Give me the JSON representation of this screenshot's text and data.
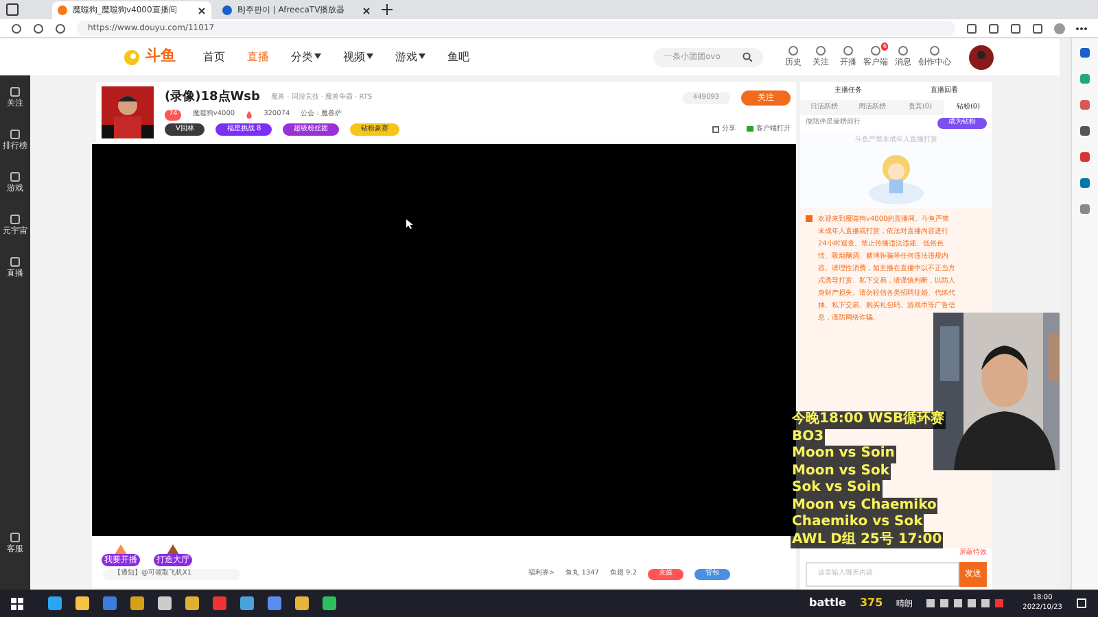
{
  "browser": {
    "tabs": [
      {
        "title": "魔噬狗_魔噬狗v4000直播间",
        "selected": true
      },
      {
        "title": "BJ주판이 | AfreecaTV播放器",
        "selected": false
      }
    ],
    "url": "https://www.douyu.com/11017"
  },
  "site": {
    "logo": "斗鱼",
    "nav": [
      {
        "label": "首页",
        "selected": false,
        "caret": false
      },
      {
        "label": "直播",
        "selected": true,
        "caret": false
      },
      {
        "label": "分类",
        "selected": false,
        "caret": true
      },
      {
        "label": "视频",
        "selected": false,
        "caret": true
      },
      {
        "label": "游戏",
        "selected": false,
        "caret": true
      },
      {
        "label": "鱼吧",
        "selected": false,
        "caret": false
      }
    ],
    "search_placeholder": "一条小团团ovo",
    "header_icons": [
      {
        "label": "历史"
      },
      {
        "label": "关注"
      },
      {
        "label": "开播"
      },
      {
        "label": "客户端",
        "badge": "6"
      },
      {
        "label": "消息"
      },
      {
        "label": "创作中心"
      }
    ]
  },
  "left_rail": [
    {
      "label": "关注"
    },
    {
      "label": "排行榜"
    },
    {
      "label": "游戏"
    },
    {
      "label": "元宇宙"
    },
    {
      "label": "直播"
    },
    {
      "label": "客服"
    }
  ],
  "streamer": {
    "title": "(录像)18点Wsb",
    "tags": "魔兽 · 同游竞技 · 魔兽争霸 · RTS",
    "level": "74",
    "name": "魔噬狗v4000",
    "hot": "320074",
    "notice": "公会：魔兽萨",
    "badges": [
      {
        "label": "V回林",
        "color": "#3a3a3a"
      },
      {
        "label": "福星挑战 8",
        "color": "#7b2ff7"
      },
      {
        "label": "超级粉丝团",
        "color": "#9b30d9"
      },
      {
        "label": "钻粉豪赛",
        "color": "#f5c518"
      }
    ],
    "followers": "449093",
    "follow": "关注",
    "share": "分享",
    "client": "客户端打开"
  },
  "panel": {
    "links": [
      "主播任务",
      "直播回看"
    ],
    "tabs": [
      {
        "label": "日活跃榜",
        "selected": false
      },
      {
        "label": "周活跃榜",
        "selected": false
      },
      {
        "label": "贵宾(0)",
        "selected": false
      },
      {
        "label": "钻粉(0)",
        "selected": true
      }
    ],
    "rank_text": "做陪伴星量榜前行",
    "rank_button": "成为钻粉",
    "empty_text": "斗鱼严禁未成年人直播打赏",
    "system_message": "欢迎来到魔噬狗v4000的直播间。斗鱼严禁未成年人直播或打赏，依法对直播内容进行24小时巡查。禁止传播违法违规、低俗色情、吸烟酗酒、赌博诈骗等任何违法违规内容。请理性消费，如主播在直播中以不正当方式诱导打赏、私下交易，请谨慎判断，以防人身财产损失。请勿轻信各类招聘征婚、代练代抽、私下交易、购买礼包码、游戏币等广告信息，谨防网络诈骗。"
  },
  "overlay_lines": [
    "今晚18:00 WSB循环赛",
    "BO3",
    "Moon vs Soin",
    "Moon vs Sok",
    "Sok vs Soin",
    "Moon vs Chaemiko",
    "Chaemiko vs Sok",
    "AWL D组 25号 17:00"
  ],
  "bottom": {
    "gifts": [
      "我要开播",
      "打造大厅"
    ],
    "notice": "【通知】@可领取飞机X1",
    "coupon": "福利券>",
    "fish_balls": "鱼丸 1347",
    "fish_fins": "鱼翅 9.2",
    "recharge": "充值",
    "backpack": "背包",
    "block_effects": "屏蔽特效",
    "chat_placeholder": "这里输入聊天内容",
    "send": "发送"
  },
  "taskbar": {
    "overlay_text": "battle",
    "overlay_count": "375",
    "weather": "晴朗",
    "time": "18:00",
    "date": "2022/10/23"
  }
}
